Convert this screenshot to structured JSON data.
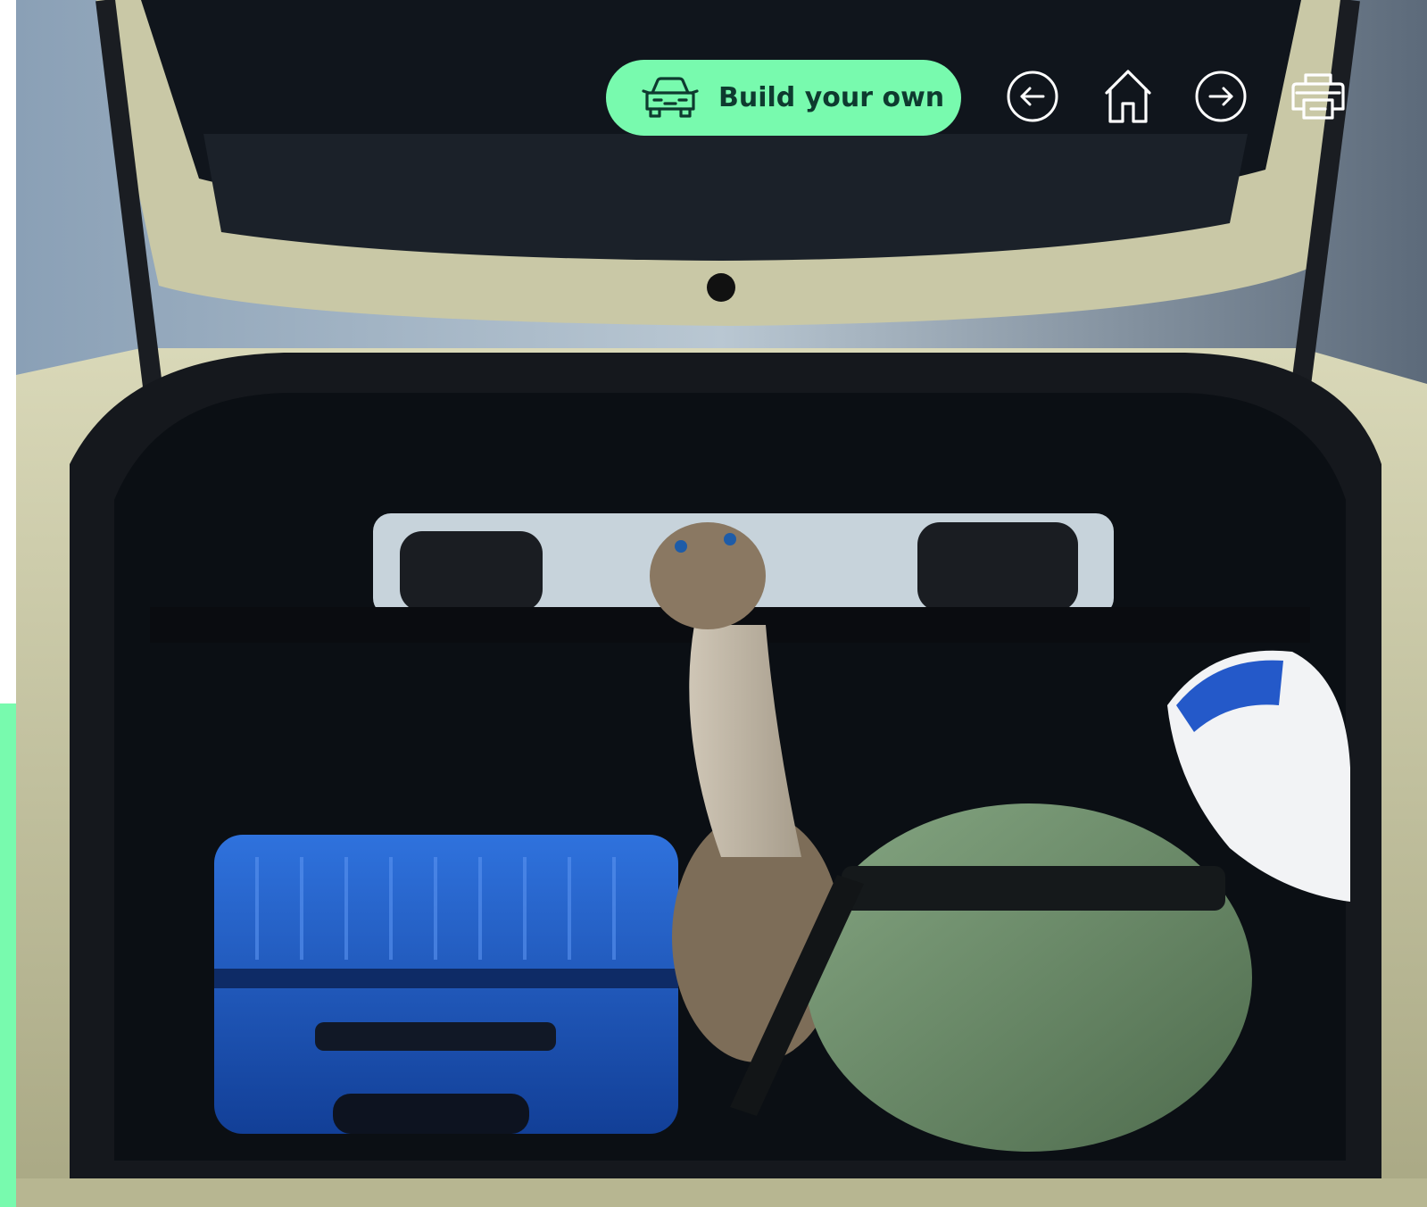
{
  "toolbar": {
    "build_label": "Build your own",
    "icons": {
      "build": "car-icon",
      "back": "arrow-left-circle-icon",
      "home": "home-icon",
      "forward": "arrow-right-circle-icon",
      "print": "printer-icon"
    }
  },
  "colors": {
    "accent": "#78faae",
    "accent_text": "#0e3a2f",
    "icon_stroke": "#ffffff",
    "car_body": "#c7c6a3",
    "suitcase": "#1f5fc7",
    "duffel_bag": "#6e8f6c",
    "trunk_interior": "#0b0f14"
  }
}
